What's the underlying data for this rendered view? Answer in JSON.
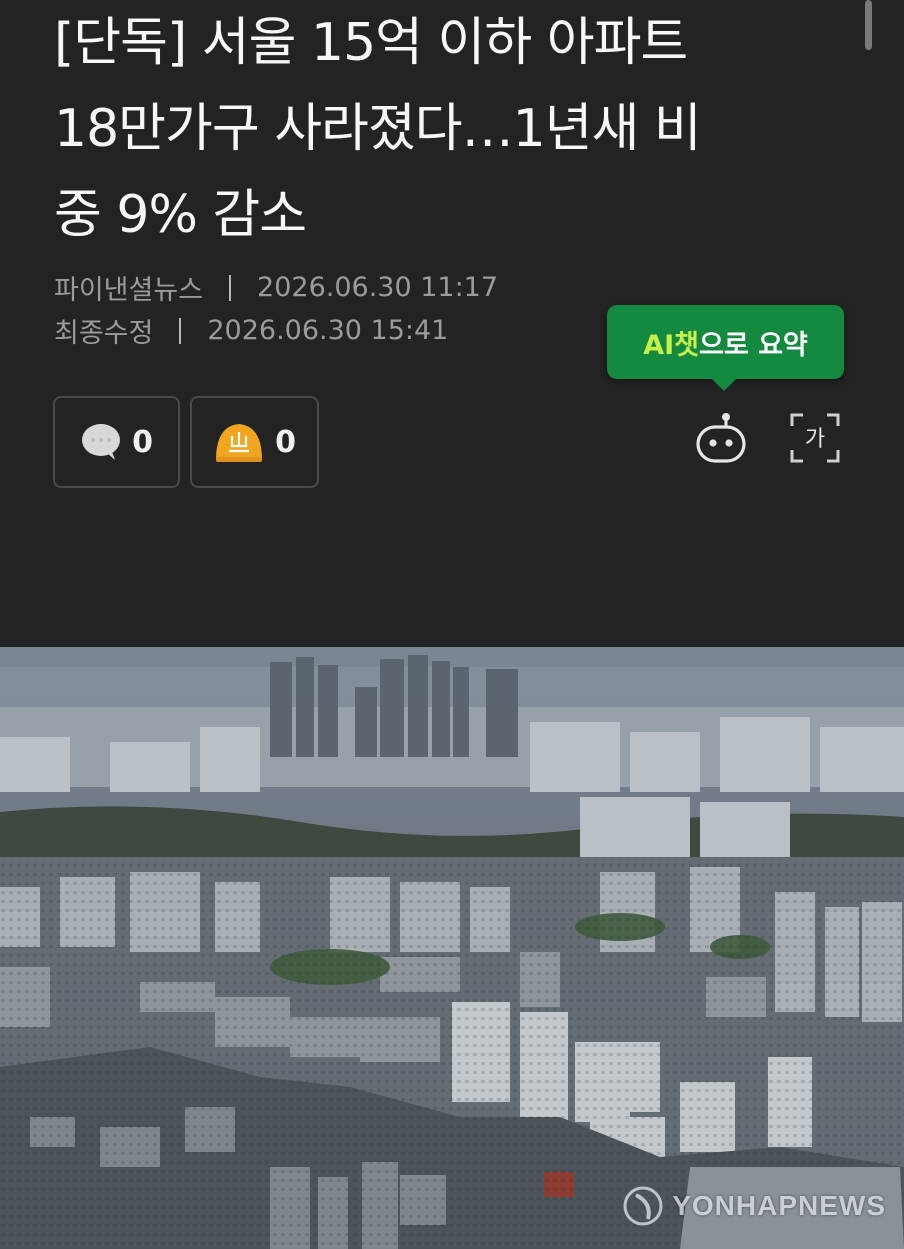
{
  "article": {
    "headline_lines": [
      "[단독] 서울 15억 이하 아파트",
      "18만가구 사라졌다…1년새 비",
      "중 9% 감소"
    ],
    "publisher": "파이낸셜뉴스",
    "published_at": "2026.06.30 11:17",
    "modified_label": "최종수정",
    "modified_at": "2026.06.30 15:41"
  },
  "reactions": {
    "comment_count": "0",
    "comment_icon": "speech-bubble-icon",
    "like_count": "0",
    "like_icon": "helmet-emoji-icon"
  },
  "toolbar": {
    "ai_tooltip_highlight": "AI챗",
    "ai_tooltip_rest": "으로 요약",
    "ai_icon": "ai-bot-icon",
    "font_icon_char": "가",
    "font_icon": "font-size-icon"
  },
  "photo": {
    "watermark": "YONHAPNEWS",
    "subject": "city-aerial-photo"
  },
  "colors": {
    "background": "#232323",
    "tooltip_green": "#138a3f",
    "tooltip_highlight": "#c7f04a",
    "meta_gray": "#9b9b9b",
    "like_orange": "#f2a51f"
  }
}
